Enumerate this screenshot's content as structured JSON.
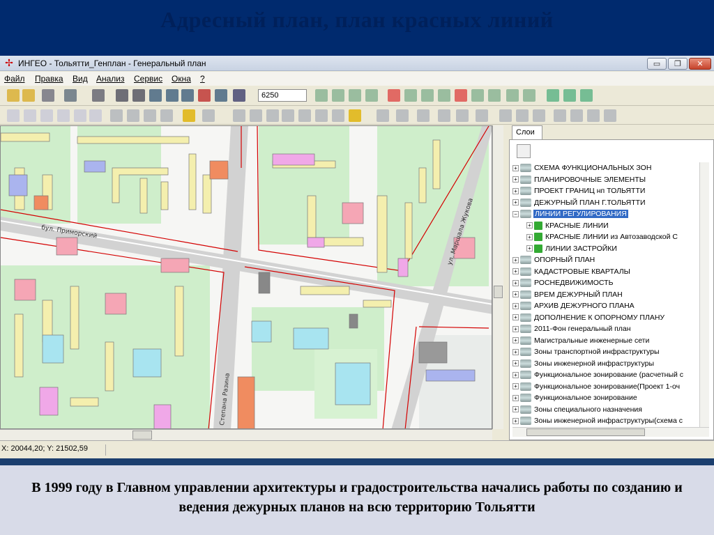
{
  "slide": {
    "title": "Адресный план,  план красных линий",
    "caption": "В 1999 году в Главном управлении архитектуры и градостроительства  начались работы по созданию и ведения дежурных планов на всю территорию Тольятти"
  },
  "window": {
    "title": "ИНГЕО - Тольятти_Генплан - Генеральный план",
    "min_glyph": "▭",
    "max_glyph": "❐",
    "close_glyph": "✕"
  },
  "menu": [
    "Файл",
    "Правка",
    "Вид",
    "Анализ",
    "Сервис",
    "Окна",
    "?"
  ],
  "toolbar": {
    "scale_value": "6250"
  },
  "map": {
    "street_labels": [
      "бул. Приморский",
      "ул. Маршала Жукова",
      "Степана Разина"
    ]
  },
  "panel": {
    "tab_label": "Слои",
    "layers": [
      {
        "label": "СХЕМА ФУНКЦИОНАЛЬНЫХ ЗОН",
        "child": false,
        "selected": false
      },
      {
        "label": "ПЛАНИРОВОЧНЫЕ ЭЛЕМЕНТЫ",
        "child": false,
        "selected": false
      },
      {
        "label": "ПРОЕКТ ГРАНИЦ нп ТОЛЬЯТТИ",
        "child": false,
        "selected": false
      },
      {
        "label": "ДЕЖУРНЫЙ ПЛАН Г.ТОЛЬЯТТИ",
        "child": false,
        "selected": false
      },
      {
        "label": "ЛИНИИ РЕГУЛИРОВАНИЯ",
        "child": false,
        "selected": true
      },
      {
        "label": "КРАСНЫЕ ЛИНИИ",
        "child": true,
        "selected": false
      },
      {
        "label": "КРАСНЫЕ ЛИНИИ из Автозаводской С",
        "child": true,
        "selected": false
      },
      {
        "label": "ЛИНИИ ЗАСТРОЙКИ",
        "child": true,
        "selected": false
      },
      {
        "label": "ОПОРНЫЙ ПЛАН",
        "child": false,
        "selected": false
      },
      {
        "label": "КАДАСТРОВЫЕ КВАРТАЛЫ",
        "child": false,
        "selected": false
      },
      {
        "label": "РОСНЕДВИЖИМОСТЬ",
        "child": false,
        "selected": false
      },
      {
        "label": "ВРЕМ ДЕЖУРНЫЙ ПЛАН",
        "child": false,
        "selected": false
      },
      {
        "label": "АРХИВ ДЕЖУРНОГО ПЛАНА",
        "child": false,
        "selected": false
      },
      {
        "label": "ДОПОЛНЕНИЕ К ОПОРНОМУ ПЛАНУ",
        "child": false,
        "selected": false
      },
      {
        "label": "2011-Фон генеральный план",
        "child": false,
        "selected": false
      },
      {
        "label": "Магистральные инженерные сети",
        "child": false,
        "selected": false
      },
      {
        "label": "Зоны транспортной инфраструктуры",
        "child": false,
        "selected": false
      },
      {
        "label": "Зоны инженерной инфраструктуры",
        "child": false,
        "selected": false
      },
      {
        "label": "Функциональное зонирование (расчетный с",
        "child": false,
        "selected": false
      },
      {
        "label": "Функциональное зонирование(Проект 1-оч",
        "child": false,
        "selected": false
      },
      {
        "label": "Функциональное зонирование",
        "child": false,
        "selected": false
      },
      {
        "label": "Зоны специального назначения",
        "child": false,
        "selected": false
      },
      {
        "label": "Зоны инженерной инфраструктуры(схема с",
        "child": false,
        "selected": false
      }
    ]
  },
  "status": {
    "coords": "X: 20044,20; Y: 21502,59"
  },
  "colors": {
    "title_band": "#002a6e",
    "selection": "#316ac5",
    "red_lines": "#d40000"
  }
}
